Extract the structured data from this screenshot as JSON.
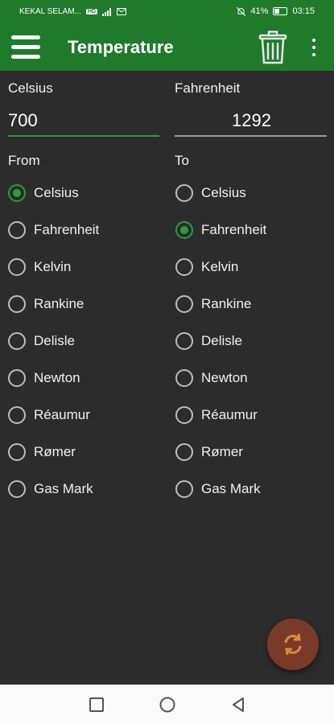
{
  "status": {
    "carrier": "KEKAL SELAM...",
    "sim_badge": "HD",
    "battery": "41%",
    "time": "03:15"
  },
  "appbar": {
    "title": "Temperature",
    "menu_icon": "hamburger-menu-icon",
    "delete_icon": "trash-icon",
    "more_icon": "more-vertical-icon"
  },
  "inputs": {
    "from_label": "Celsius",
    "from_value": "700",
    "to_label": "Fahrenheit",
    "to_value": "1292"
  },
  "from_heading": "From",
  "to_heading": "To",
  "units": [
    "Celsius",
    "Fahrenheit",
    "Kelvin",
    "Rankine",
    "Delisle",
    "Newton",
    "Réaumur",
    "Rømer",
    "Gas Mark"
  ],
  "selected_from": "Celsius",
  "selected_to": "Fahrenheit",
  "fab": {
    "icon": "swap-refresh-icon"
  },
  "colors": {
    "primary": "#1f7a2b",
    "accent": "#2e9b3c",
    "background": "#2c2c2c",
    "fab": "#7a3a2a"
  }
}
